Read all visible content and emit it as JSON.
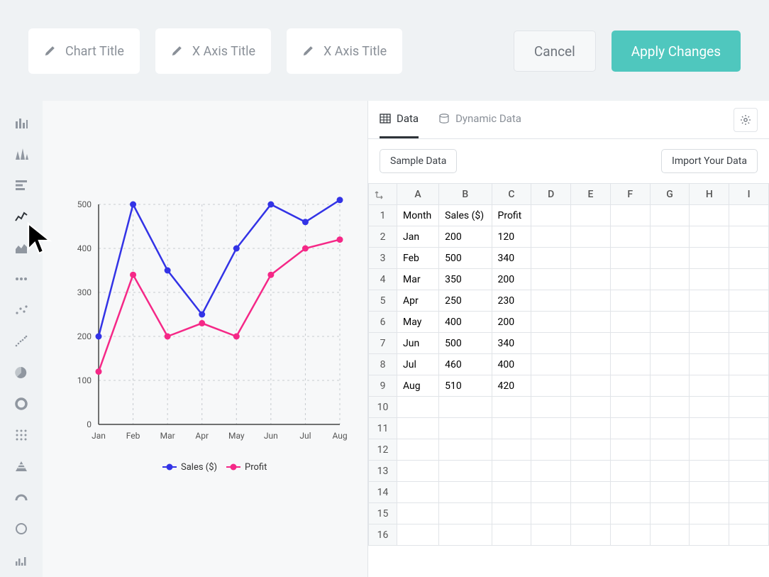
{
  "topbar": {
    "chart_title_placeholder": "Chart Title",
    "x_axis_placeholder_1": "X Axis Title",
    "x_axis_placeholder_2": "X Axis Title",
    "cancel_label": "Cancel",
    "apply_label": "Apply Changes"
  },
  "sidebar": {
    "items": [
      {
        "name": "bar-chart-icon",
        "active": false
      },
      {
        "name": "sharp-bar-icon",
        "active": false
      },
      {
        "name": "horizontal-bars-icon",
        "active": false
      },
      {
        "name": "line-chart-icon",
        "active": true
      },
      {
        "name": "area-chart-icon",
        "active": false
      },
      {
        "name": "dots-row-icon",
        "active": false
      },
      {
        "name": "scatter-sparse-icon",
        "active": false
      },
      {
        "name": "scatter-dense-icon",
        "active": false
      },
      {
        "name": "pie-chart-icon",
        "active": false
      },
      {
        "name": "donut-chart-icon",
        "active": false
      },
      {
        "name": "dot-grid-icon",
        "active": false
      },
      {
        "name": "pyramid-icon",
        "active": false
      },
      {
        "name": "gauge-arc-icon",
        "active": false
      },
      {
        "name": "circle-outline-icon",
        "active": false
      },
      {
        "name": "sparkline-bars-icon",
        "active": false
      }
    ]
  },
  "data_tabs": {
    "data_label": "Data",
    "dynamic_label": "Dynamic Data",
    "sample_btn": "Sample Data",
    "import_btn": "Import Your Data"
  },
  "spreadsheet": {
    "columns": [
      "A",
      "B",
      "C",
      "D",
      "E",
      "F",
      "G",
      "H",
      "I"
    ],
    "rows": [
      [
        "Month",
        "Sales ($)",
        "Profit",
        "",
        "",
        "",
        "",
        "",
        ""
      ],
      [
        "Jan",
        "200",
        "120",
        "",
        "",
        "",
        "",
        "",
        ""
      ],
      [
        "Feb",
        "500",
        "340",
        "",
        "",
        "",
        "",
        "",
        ""
      ],
      [
        "Mar",
        "350",
        "200",
        "",
        "",
        "",
        "",
        "",
        ""
      ],
      [
        "Apr",
        "250",
        "230",
        "",
        "",
        "",
        "",
        "",
        ""
      ],
      [
        "May",
        "400",
        "200",
        "",
        "",
        "",
        "",
        "",
        ""
      ],
      [
        "Jun",
        "500",
        "340",
        "",
        "",
        "",
        "",
        "",
        ""
      ],
      [
        "Jul",
        "460",
        "400",
        "",
        "",
        "",
        "",
        "",
        ""
      ],
      [
        "Aug",
        "510",
        "420",
        "",
        "",
        "",
        "",
        "",
        ""
      ],
      [
        "",
        "",
        "",
        "",
        "",
        "",
        "",
        "",
        ""
      ],
      [
        "",
        "",
        "",
        "",
        "",
        "",
        "",
        "",
        ""
      ],
      [
        "",
        "",
        "",
        "",
        "",
        "",
        "",
        "",
        ""
      ],
      [
        "",
        "",
        "",
        "",
        "",
        "",
        "",
        "",
        ""
      ],
      [
        "",
        "",
        "",
        "",
        "",
        "",
        "",
        "",
        ""
      ],
      [
        "",
        "",
        "",
        "",
        "",
        "",
        "",
        "",
        ""
      ],
      [
        "",
        "",
        "",
        "",
        "",
        "",
        "",
        "",
        ""
      ]
    ]
  },
  "chart_data": {
    "type": "line",
    "categories": [
      "Jan",
      "Feb",
      "Mar",
      "Apr",
      "May",
      "Jun",
      "Jul",
      "Aug"
    ],
    "series": [
      {
        "name": "Sales ($)",
        "color": "#3333E6",
        "values": [
          200,
          500,
          350,
          250,
          400,
          500,
          460,
          510
        ]
      },
      {
        "name": "Profit",
        "color": "#F52887",
        "values": [
          120,
          340,
          200,
          230,
          200,
          340,
          400,
          420
        ]
      }
    ],
    "ylim": [
      0,
      500
    ],
    "yticks": [
      0,
      100,
      200,
      300,
      400,
      500
    ],
    "xlabel": "",
    "ylabel": "",
    "title": "",
    "legend_position": "bottom"
  },
  "colors": {
    "accent": "#4FC7BE"
  }
}
